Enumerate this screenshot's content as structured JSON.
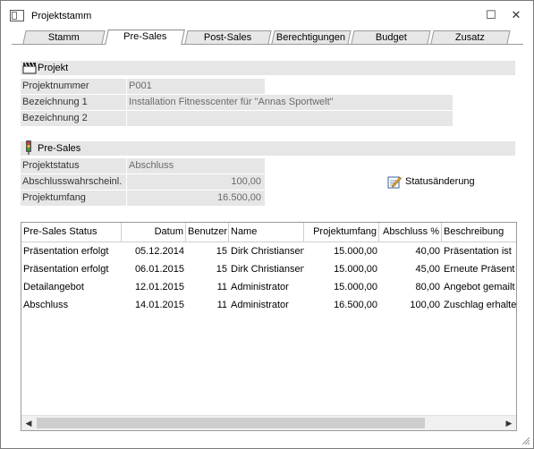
{
  "window": {
    "title": "Projektstamm",
    "minimize_glyph": "☐",
    "close_glyph": "✕"
  },
  "tabs": [
    {
      "label": "Stamm"
    },
    {
      "label": "Pre-Sales"
    },
    {
      "label": "Post-Sales"
    },
    {
      "label": "Berechtigungen"
    },
    {
      "label": "Budget"
    },
    {
      "label": "Zusatz"
    }
  ],
  "projekt": {
    "header": "Projekt",
    "projektnummer_label": "Projektnummer",
    "projektnummer_value": "P001",
    "bezeichnung1_label": "Bezeichnung 1",
    "bezeichnung1_value": "Installation Fitnesscenter für \"Annas Sportwelt\"",
    "bezeichnung2_label": "Bezeichnung 2",
    "bezeichnung2_value": ""
  },
  "presales": {
    "header": "Pre-Sales",
    "projektstatus_label": "Projektstatus",
    "projektstatus_value": "Abschluss",
    "abschluss_label": "Abschlusswahrscheinl.",
    "abschluss_value": "100,00",
    "umfang_label": "Projektumfang",
    "umfang_value": "16.500,00",
    "statusaenderung_label": "Statusänderung"
  },
  "grid": {
    "columns": [
      "Pre-Sales Status",
      "Datum",
      "Benutzer",
      "Name",
      "Projektumfang",
      "Abschluss %",
      "Beschreibung"
    ],
    "rows": [
      {
        "status": "Präsentation erfolgt",
        "datum": "05.12.2014",
        "benutzer": "15",
        "name": "Dirk Christiansen",
        "umfang": "15.000,00",
        "abschluss": "40,00",
        "beschreibung": "Präsentation ist"
      },
      {
        "status": "Präsentation erfolgt",
        "datum": "06.01.2015",
        "benutzer": "15",
        "name": "Dirk Christiansen",
        "umfang": "15.000,00",
        "abschluss": "45,00",
        "beschreibung": "Erneute Präsent"
      },
      {
        "status": "Detailangebot",
        "datum": "12.01.2015",
        "benutzer": "11",
        "name": "Administrator",
        "umfang": "15.000,00",
        "abschluss": "80,00",
        "beschreibung": "Angebot gemailt"
      },
      {
        "status": "Abschluss",
        "datum": "14.01.2015",
        "benutzer": "11",
        "name": "Administrator",
        "umfang": "16.500,00",
        "abschluss": "100,00",
        "beschreibung": "Zuschlag erhalte"
      }
    ],
    "scroll_left": "◀",
    "scroll_right": "▶"
  }
}
